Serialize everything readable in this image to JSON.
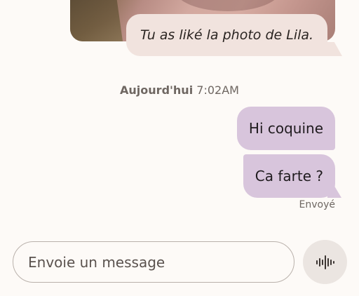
{
  "conversation": {
    "received_reply": {
      "text": "Tu as liké la photo de Lila."
    },
    "date_separator": {
      "day": "Aujourd'hui",
      "time": "7:02AM"
    },
    "messages": [
      {
        "text": "Hi coquine"
      },
      {
        "text": "Ca farte ?"
      }
    ],
    "status": "Envoyé"
  },
  "compose": {
    "placeholder": "Envoie un message"
  },
  "icons": {
    "voice": "waveform-icon"
  },
  "colors": {
    "background": "#fdfaf7",
    "received_bubble": "#f1e3de",
    "sent_bubble": "#d8c5dc",
    "voice_button": "#ebe5e1"
  }
}
